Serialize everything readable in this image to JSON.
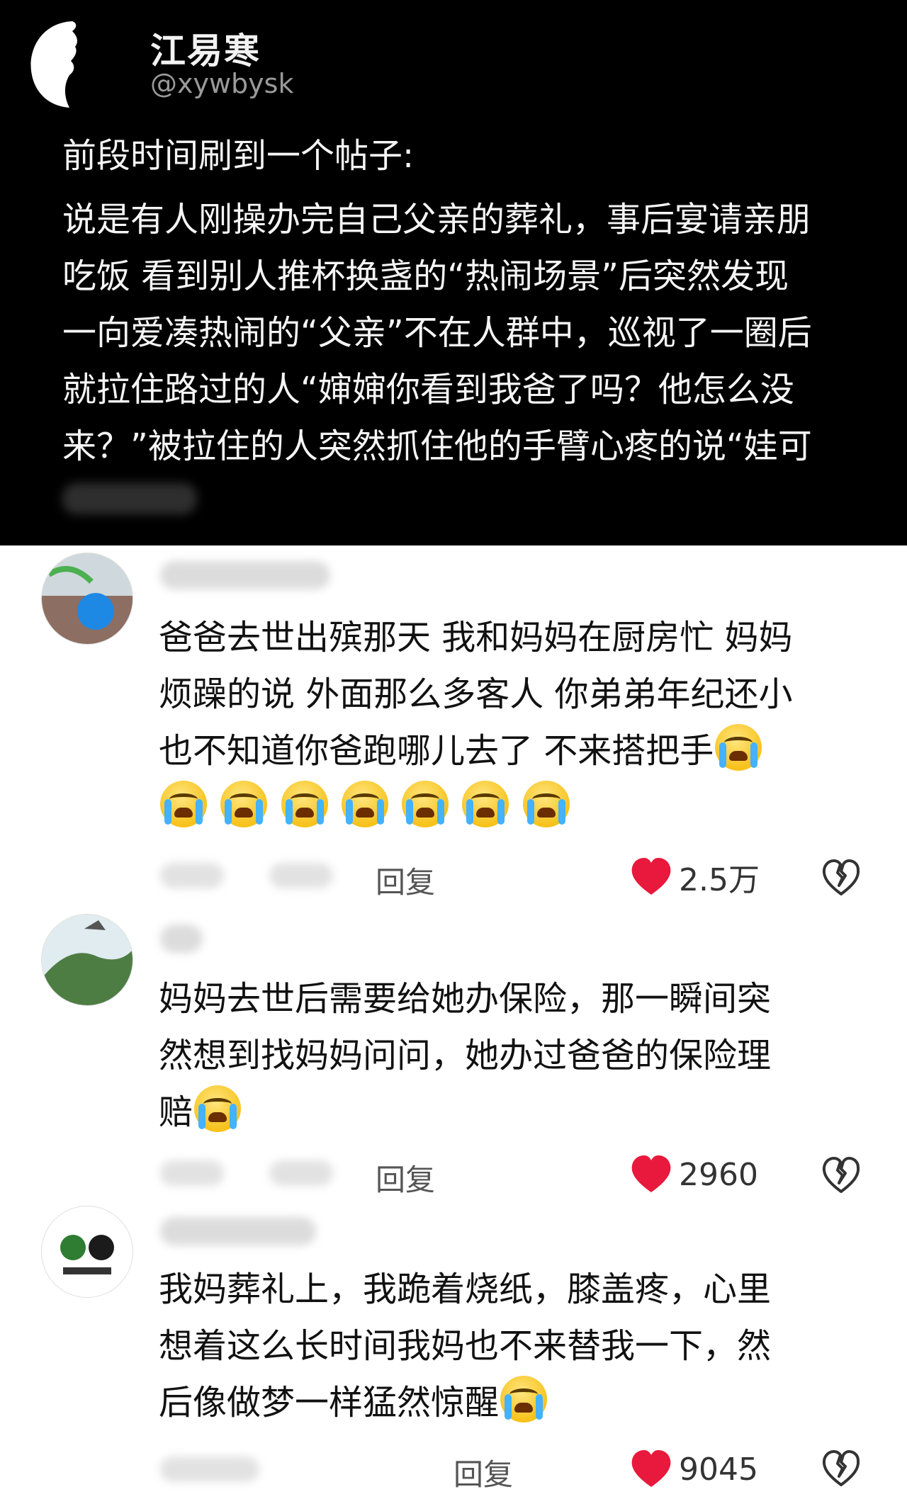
{
  "post": {
    "author_name": "江易寒",
    "author_handle": "@xywbysk",
    "lead": "前段时间刷到一个帖子:",
    "lines": [
      "说是有人刚操办完自己父亲的葬礼，事后宴请亲朋",
      "吃饭 看到别人推杯换盏的“热闹场景”后突然发现",
      "一向爱凑热闹的“父亲”不在人群中，巡视了一圈后",
      "就拉住路过的人“婶婶你看到我爸了吗？他怎么没",
      "来？”被拉住的人突然抓住他的手臂心疼的说“娃可"
    ]
  },
  "comments": [
    {
      "lines": [
        "爸爸去世出殡那天 我和妈妈在厨房忙 妈妈",
        "烦躁的说 外面那么多客人 你弟弟年纪还小",
        "也不知道你爸跑哪儿去了 不来搭把手"
      ],
      "reply_label": "回复",
      "likes": "2.5万"
    },
    {
      "lines": [
        "妈妈去世后需要给她办保险，那一瞬间突",
        "然想到找妈妈问问，她办过爸爸的保险理",
        "赔"
      ],
      "reply_label": "回复",
      "likes": "2960"
    },
    {
      "lines": [
        "我妈葬礼上，我跪着烧纸，膝盖疼，心里",
        "想着这么长时间我妈也不来替我一下，然",
        "后像做梦一样猛然惊醒"
      ],
      "reply_label": "回复",
      "likes": "9045"
    }
  ],
  "colors": {
    "post_bg": "#000000",
    "page_bg": "#ffffff",
    "heart": "#e8193c"
  },
  "icons": [
    "crying-emoji",
    "heart-icon",
    "dislike-icon"
  ]
}
